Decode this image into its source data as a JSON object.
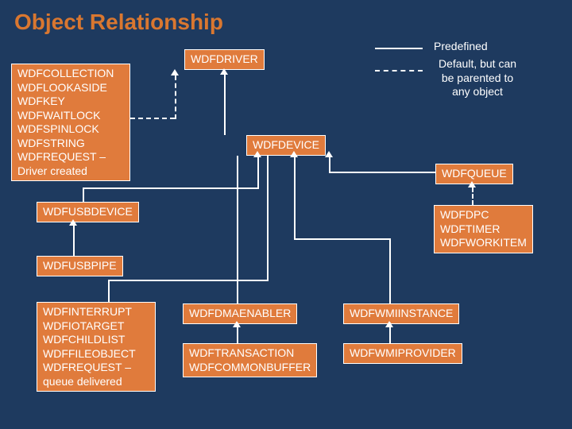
{
  "title": "Object Relationship",
  "legend": {
    "predefined": "Predefined",
    "default_text": "Default, but can be parented to any object"
  },
  "boxes": {
    "collection": "WDFCOLLECTION\nWDFLOOKASIDE\nWDFKEY\nWDFWAITLOCK\nWDFSPINLOCK\nWDFSTRING\nWDFREQUEST – Driver created",
    "driver": "WDFDRIVER",
    "device": "WDFDEVICE",
    "queue": "WDFQUEUE",
    "usbdevice": "WDFUSBDEVICE",
    "usbpipe": "WDFUSBPIPE",
    "interrupt": "WDFINTERRUPT\nWDFIOTARGET\nWDFCHILDLIST\nWDFFILEOBJECT\nWDFREQUEST – queue delivered",
    "dmaenabler": "WDFDMAENABLER",
    "transaction": "WDFTRANSACTION\nWDFCOMMONBUFFER",
    "wmiinstance": "WDFWMIINSTANCE",
    "wmiprovider": "WDFWMIPROVIDER",
    "dpc": "WDFDPC\nWDFTIMER\nWDFWORKITEM"
  }
}
